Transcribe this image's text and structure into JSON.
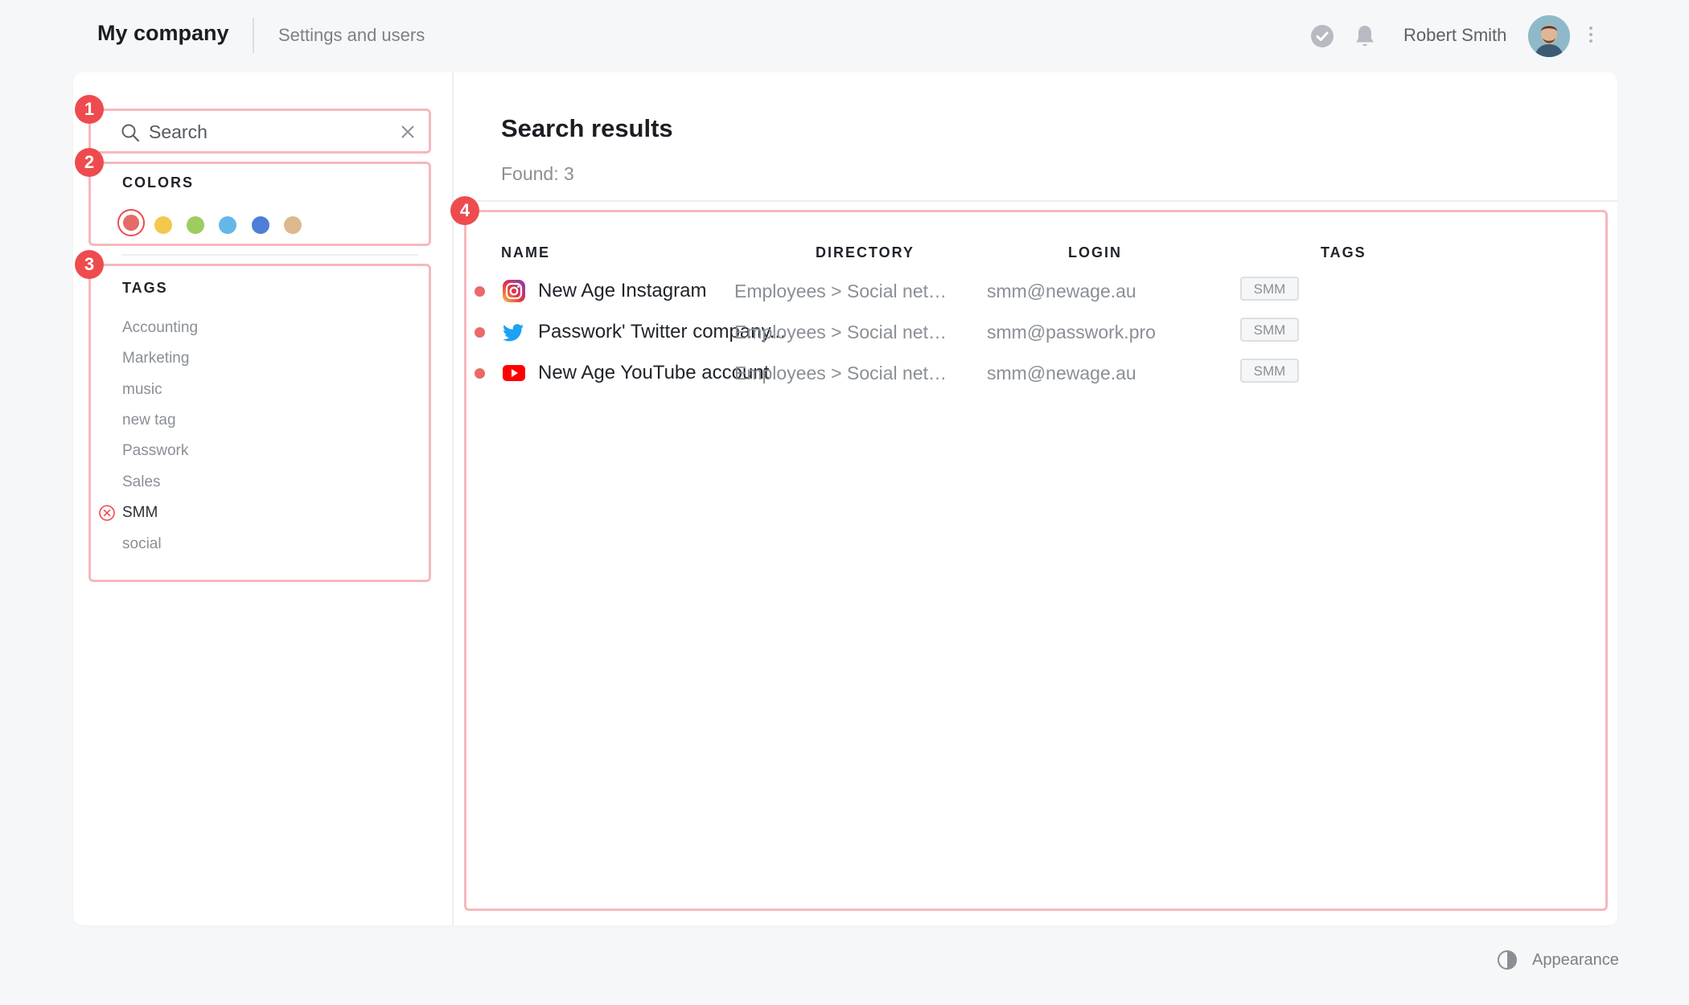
{
  "header": {
    "app_title": "My company",
    "nav_link": "Settings and users",
    "user_name": "Robert Smith"
  },
  "annotations": [
    "1",
    "2",
    "3",
    "4"
  ],
  "search": {
    "placeholder": "Search",
    "value": ""
  },
  "colors": {
    "title": "COLORS",
    "swatches": [
      "#e56b66",
      "#f3c84b",
      "#9dcd5e",
      "#64b7e7",
      "#4d7fd8",
      "#ddb88e"
    ],
    "selected_index": 0
  },
  "tags": {
    "title": "TAGS",
    "items": [
      "Accounting",
      "Marketing",
      "music",
      "new tag",
      "Passwork",
      "Sales",
      "SMM",
      "social"
    ],
    "active": "SMM"
  },
  "results": {
    "title": "Search results",
    "count": "Found: 3",
    "columns": [
      "NAME",
      "DIRECTORY",
      "LOGIN",
      "TAGS"
    ],
    "rows": [
      {
        "icon": "instagram-icon",
        "name": "New Age Instagram",
        "directory": "Employees > Social net…",
        "login": "smm@newage.au",
        "tag": "SMM"
      },
      {
        "icon": "twitter-icon",
        "name": "Passwork' Twitter company...",
        "directory": "Employees > Social net…",
        "login": "smm@passwork.pro",
        "tag": "SMM"
      },
      {
        "icon": "youtube-icon",
        "name": "New Age YouTube account",
        "directory": "Employees > Social net…",
        "login": "smm@newage.au",
        "tag": "SMM"
      }
    ]
  },
  "footer": {
    "appearance_label": "Appearance"
  }
}
